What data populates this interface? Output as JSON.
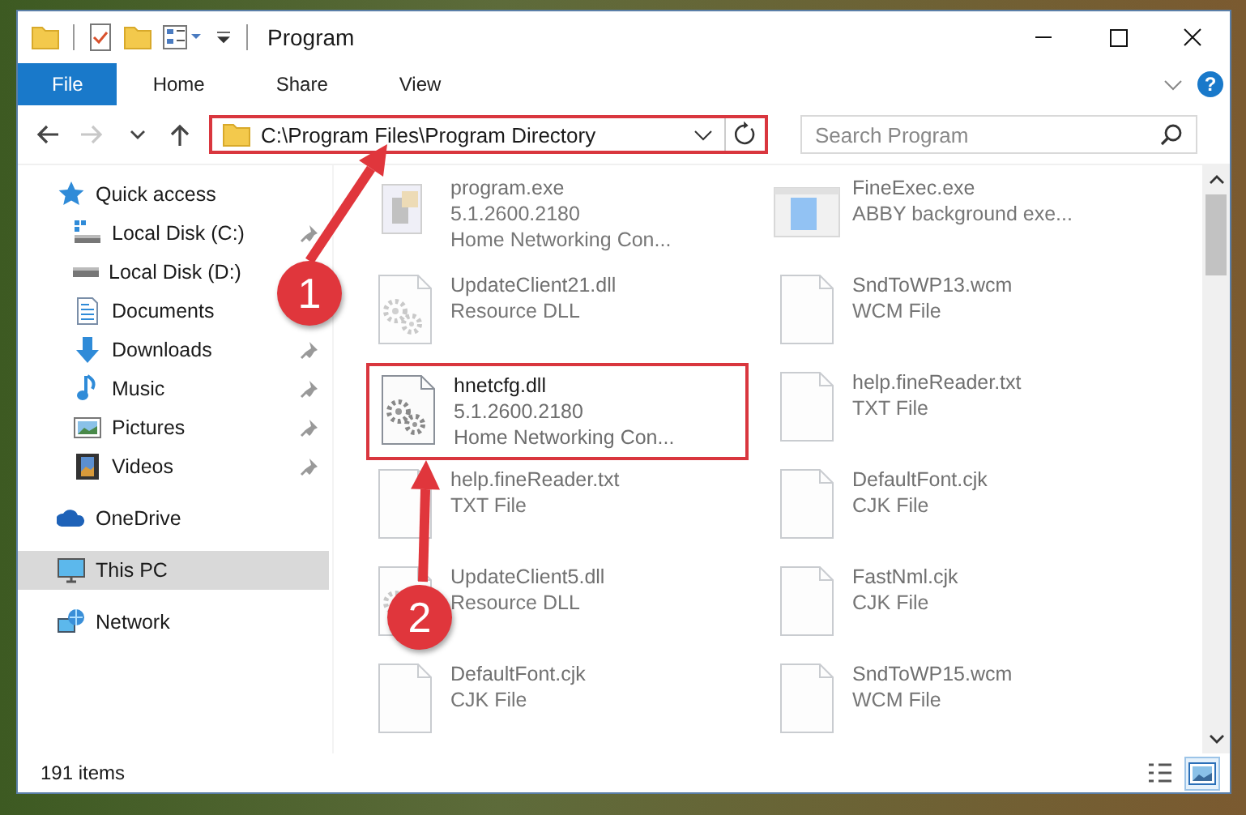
{
  "window": {
    "title": "Program"
  },
  "quick_toolbar": [
    {
      "kind": "folder"
    },
    {
      "kind": "checklist"
    },
    {
      "kind": "folder"
    },
    {
      "kind": "properties"
    }
  ],
  "ribbon": {
    "tabs": [
      {
        "label": "File",
        "selected": true
      },
      {
        "label": "Home",
        "selected": false
      },
      {
        "label": "Share",
        "selected": false
      },
      {
        "label": "View",
        "selected": false
      }
    ],
    "help": "?"
  },
  "navigation": {
    "buttons": [
      {
        "kind": "back",
        "disabled": false
      },
      {
        "kind": "forward",
        "disabled": true
      },
      {
        "kind": "recent",
        "disabled": false
      },
      {
        "kind": "up",
        "disabled": false
      }
    ],
    "address": {
      "path": "C:\\Program Files\\Program Directory",
      "highlighted": true
    },
    "search": {
      "placeholder": "Search Program"
    }
  },
  "sidebar": {
    "items": [
      {
        "label": "Quick access",
        "kind": "star",
        "selected": false,
        "children": [
          {
            "label": "Local Disk (C:)",
            "kind": "drive-c",
            "pinned": true,
            "selected": false
          },
          {
            "label": "Local Disk (D:)",
            "kind": "drive",
            "pinned": false,
            "selected": false
          },
          {
            "label": "Documents",
            "kind": "documents",
            "pinned": false,
            "selected": false
          },
          {
            "label": "Downloads",
            "kind": "downloads",
            "pinned": true,
            "selected": false
          },
          {
            "label": "Music",
            "kind": "music",
            "pinned": true,
            "selected": false
          },
          {
            "label": "Pictures",
            "kind": "pictures",
            "pinned": true,
            "selected": false
          },
          {
            "label": "Videos",
            "kind": "videos",
            "pinned": true,
            "selected": false
          }
        ]
      },
      {
        "label": "OneDrive",
        "kind": "cloud",
        "selected": false
      },
      {
        "label": "This PC",
        "kind": "pc",
        "selected": true
      },
      {
        "label": "Network",
        "kind": "network",
        "selected": false
      }
    ]
  },
  "files": [
    {
      "name": "program.exe",
      "details": [
        "5.1.2600.2180",
        "Home Networking Con..."
      ],
      "kind": "app",
      "highlighted": false
    },
    {
      "name": "FineExec.exe",
      "details": [
        "ABBY background exe..."
      ],
      "kind": "app-blue",
      "highlighted": false
    },
    {
      "name": "UpdateClient21.dll",
      "details": [
        "Resource DLL"
      ],
      "kind": "dll",
      "highlighted": false
    },
    {
      "name": "SndToWP13.wcm",
      "details": [
        "WCM File"
      ],
      "kind": "doc",
      "highlighted": false
    },
    {
      "name": "hnetcfg.dll",
      "details": [
        "5.1.2600.2180",
        "Home Networking Con..."
      ],
      "kind": "dll",
      "highlighted": true
    },
    {
      "name": "help.fineReader.txt",
      "details": [
        "TXT File"
      ],
      "kind": "doc",
      "highlighted": false
    },
    {
      "name": "help.fineReader.txt",
      "details": [
        "TXT File"
      ],
      "kind": "doc",
      "highlighted": false
    },
    {
      "name": "DefaultFont.cjk",
      "details": [
        "CJK File"
      ],
      "kind": "doc",
      "highlighted": false
    },
    {
      "name": "UpdateClient5.dll",
      "details": [
        "Resource DLL"
      ],
      "kind": "dll",
      "highlighted": false
    },
    {
      "name": "FastNml.cjk",
      "details": [
        "CJK File"
      ],
      "kind": "doc",
      "highlighted": false
    },
    {
      "name": "DefaultFont.cjk",
      "details": [
        "CJK File"
      ],
      "kind": "doc",
      "highlighted": false
    },
    {
      "name": "SndToWP15.wcm",
      "details": [
        "WCM File"
      ],
      "kind": "doc",
      "highlighted": false
    }
  ],
  "status_bar": {
    "count": "191 items",
    "views": [
      {
        "kind": "details",
        "selected": false
      },
      {
        "kind": "large-icons",
        "selected": true
      }
    ]
  },
  "annotations": [
    {
      "label": "1"
    },
    {
      "label": "2"
    }
  ]
}
